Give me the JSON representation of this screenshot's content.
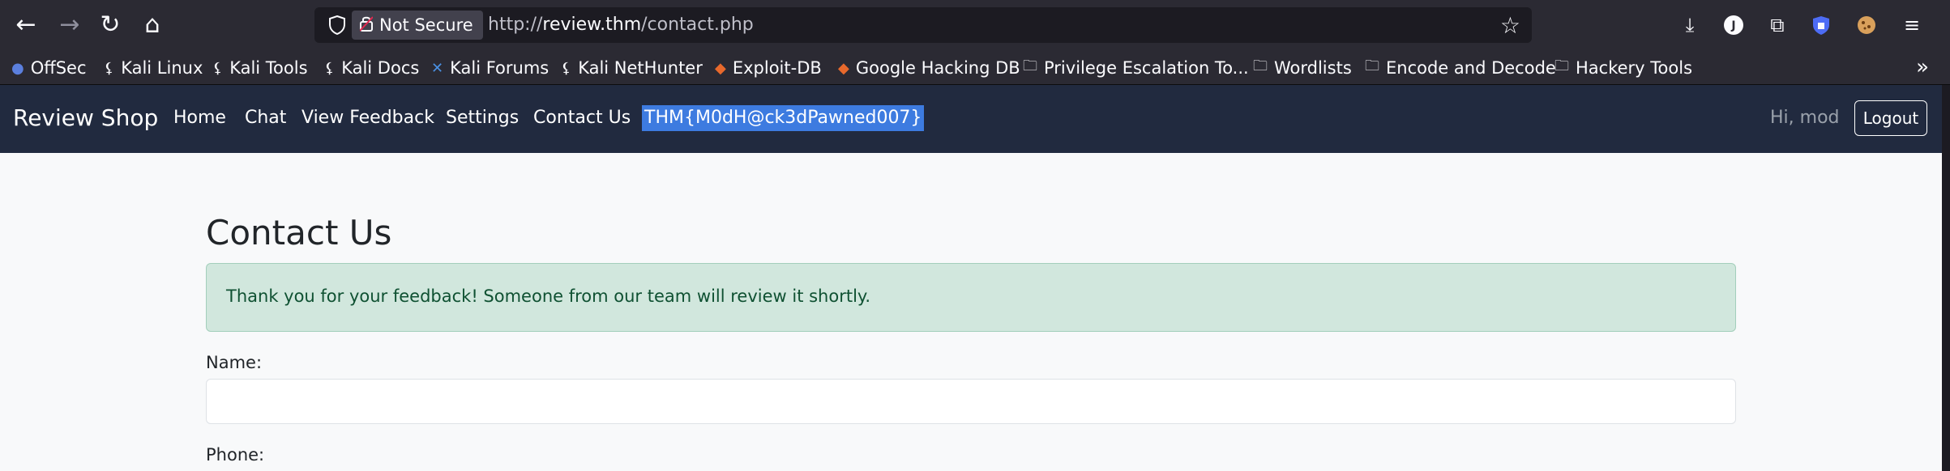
{
  "browser": {
    "back_icon": "←",
    "forward_icon": "→",
    "reload_icon": "↻",
    "home_icon": "⌂",
    "security_label": "Not Secure",
    "url_prefix": "http://",
    "url_host": "review.thm",
    "url_path": "/contact.php",
    "bookmarks": [
      {
        "label": "OffSec",
        "icon": "globe-icon"
      },
      {
        "label": "Kali Linux",
        "icon": "kali-dragon-icon"
      },
      {
        "label": "Kali Tools",
        "icon": "kali-dragon-icon"
      },
      {
        "label": "Kali Docs",
        "icon": "kali-dragon-icon"
      },
      {
        "label": "Kali Forums",
        "icon": "kali-forums-icon"
      },
      {
        "label": "Kali NetHunter",
        "icon": "kali-dragon-icon"
      },
      {
        "label": "Exploit-DB",
        "icon": "exploit-db-icon"
      },
      {
        "label": "Google Hacking DB",
        "icon": "exploit-db-icon"
      },
      {
        "label": "Privilege Escalation To...",
        "icon": "folder-icon"
      },
      {
        "label": "Wordlists",
        "icon": "folder-icon"
      },
      {
        "label": "Encode and Decode",
        "icon": "folder-icon"
      },
      {
        "label": "Hackery Tools",
        "icon": "folder-icon"
      }
    ]
  },
  "navbar": {
    "brand": "Review Shop",
    "links": [
      "Home",
      "Chat",
      "View Feedback",
      "Settings",
      "Contact Us"
    ],
    "flag": "THM{M0dH@ck3dPawned007}",
    "greeting": "Hi, mod",
    "logout_label": "Logout"
  },
  "main": {
    "title": "Contact Us",
    "alert": "Thank you for your feedback! Someone from our team will review it shortly.",
    "name_label": "Name:",
    "name_value": "",
    "phone_label": "Phone:"
  },
  "colors": {
    "navbar_bg": "#212a3f",
    "alert_bg": "#d1e7dd",
    "alert_text": "#0f5132",
    "selection": "#3d7be0"
  }
}
